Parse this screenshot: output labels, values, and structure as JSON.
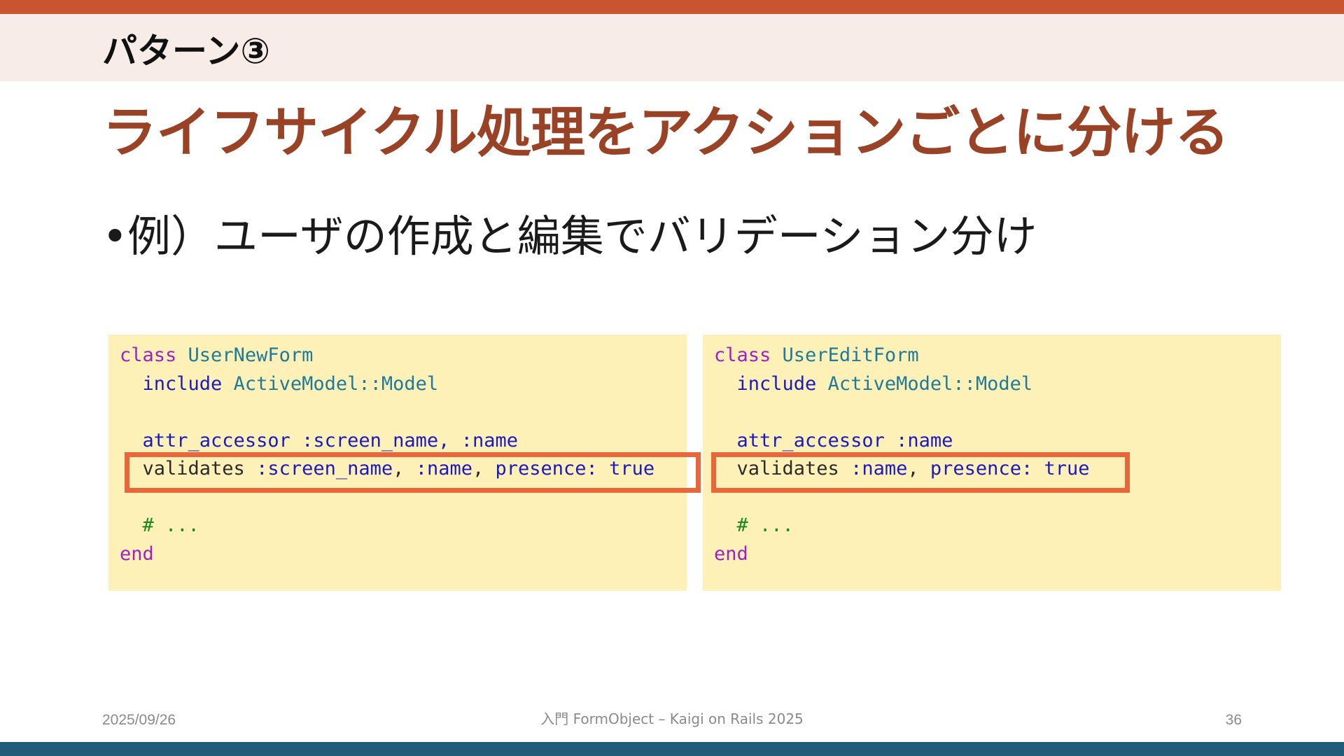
{
  "slide": {
    "section_label": "パターン③",
    "title": "ライフサイクル処理をアクションごとに分ける",
    "bullet": "例）ユーザの作成と編集でバリデーション分け"
  },
  "code_left": {
    "kw_class": "class",
    "class_name": "UserNewForm",
    "kw_include": "include",
    "module": "ActiveModel::Model",
    "attr_kw": "attr_accessor",
    "attr_args": ":screen_name, :name",
    "validates_kw": "validates",
    "validates_sym1": ":screen_name",
    "comma1": ",",
    "validates_sym2": ":name",
    "comma2": ",",
    "validates_opts": "presence: true",
    "comment": "# ...",
    "kw_end": "end"
  },
  "code_right": {
    "kw_class": "class",
    "class_name": "UserEditForm",
    "kw_include": "include",
    "module": "ActiveModel::Model",
    "attr_kw": "attr_accessor",
    "attr_args": ":name",
    "validates_kw": "validates",
    "validates_sym1": ":name",
    "comma1": ",",
    "validates_opts": "presence: true",
    "comment": "# ...",
    "kw_end": "end"
  },
  "footer": {
    "date": "2025/09/26",
    "center": "入門 FormObject – Kaigi on Rails 2025",
    "page": "36"
  },
  "colors": {
    "accent": "#c85530",
    "title": "#9a4226",
    "highlight": "#e8663a",
    "code_bg": "#fdf1b8",
    "bottom_bar": "#1e5c78"
  }
}
